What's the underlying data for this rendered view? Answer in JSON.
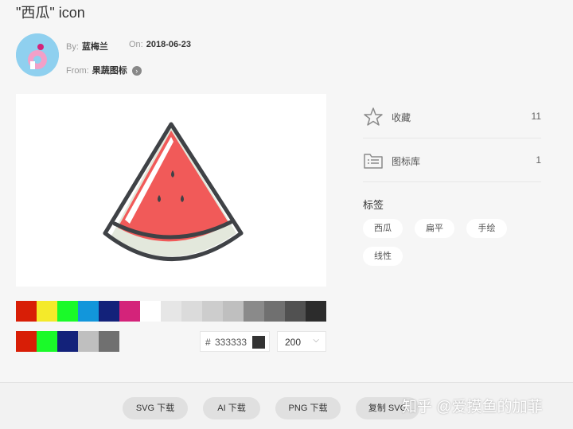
{
  "page_title": "\"西瓜\" icon",
  "author": {
    "by_label": "By:",
    "by_value": "蓝梅兰",
    "on_label": "On:",
    "on_value": "2018-06-23",
    "from_label": "From:",
    "from_value": "果蔬图标"
  },
  "palette_row1": [
    "#d81e06",
    "#f4ea2a",
    "#1afa29",
    "#1296db",
    "#13227a",
    "#d4237a",
    "#ffffff",
    "#e6e6e6",
    "#dbdbdb",
    "#cdcdcd",
    "#bfbfbf",
    "#8a8a8a",
    "#707070",
    "#515151",
    "#2c2c2c"
  ],
  "palette_row2": [
    "#d81e06",
    "#1afa29",
    "#13227a",
    "#bfbfbf",
    "#707070"
  ],
  "color_input": {
    "hash": "#",
    "value": "333333",
    "current": "#333333"
  },
  "size_select": {
    "value": "200"
  },
  "stats": [
    {
      "label": "收藏",
      "count": "11",
      "icon": "star-icon"
    },
    {
      "label": "图标库",
      "count": "1",
      "icon": "folder-list-icon"
    }
  ],
  "tags": {
    "title": "标签",
    "items": [
      "西瓜",
      "扁平",
      "手绘",
      "线性"
    ]
  },
  "buttons": [
    "SVG 下载",
    "AI 下载",
    "PNG 下载",
    "复制 SVG"
  ],
  "watermark": "知乎 @爱摸鱼的加菲",
  "icon_colors": {
    "outline": "#3f4246",
    "flesh": "#f15a59",
    "rind": "#e3e8dc",
    "seed": "#3f4246"
  }
}
